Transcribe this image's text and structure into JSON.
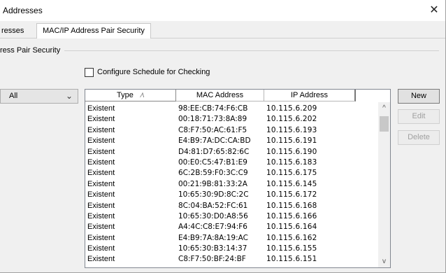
{
  "window": {
    "title": "Addresses",
    "close_glyph": "✕"
  },
  "tabs": [
    {
      "label": "resses",
      "active": false
    },
    {
      "label": "MAC/IP Address Pair Security",
      "active": true
    }
  ],
  "group": {
    "title": "ress Pair Security"
  },
  "schedule_checkbox": {
    "label": "Configure Schedule for Checking",
    "checked": false
  },
  "filter": {
    "selected": "All",
    "arrow_icon": "chevron-down-icon"
  },
  "table": {
    "columns": [
      "Type",
      "MAC Address",
      "IP Address"
    ],
    "sort_glyph": "⁄\\",
    "rows": [
      {
        "type": "Existent",
        "mac": "98:EE:CB:74:F6:CB",
        "ip": "10.115.6.209"
      },
      {
        "type": "Existent",
        "mac": "00:18:71:73:8A:89",
        "ip": "10.115.6.202"
      },
      {
        "type": "Existent",
        "mac": "C8:F7:50:AC:61:F5",
        "ip": "10.115.6.193"
      },
      {
        "type": "Existent",
        "mac": "E4:B9:7A:DC:CA:BD",
        "ip": "10.115.6.191"
      },
      {
        "type": "Existent",
        "mac": "D4:81:D7:65:82:6C",
        "ip": "10.115.6.190"
      },
      {
        "type": "Existent",
        "mac": "00:E0:C5:47:B1:E9",
        "ip": "10.115.6.183"
      },
      {
        "type": "Existent",
        "mac": "6C:2B:59:F0:3C:C9",
        "ip": "10.115.6.175"
      },
      {
        "type": "Existent",
        "mac": "00:21:9B:81:33:2A",
        "ip": "10.115.6.145"
      },
      {
        "type": "Existent",
        "mac": "10:65:30:9D:8C:2C",
        "ip": "10.115.6.172"
      },
      {
        "type": "Existent",
        "mac": "8C:04:BA:52:FC:61",
        "ip": "10.115.6.168"
      },
      {
        "type": "Existent",
        "mac": "10:65:30:D0:A8:56",
        "ip": "10.115.6.166"
      },
      {
        "type": "Existent",
        "mac": "A4:4C:C8:E7:94:F6",
        "ip": "10.115.6.164"
      },
      {
        "type": "Existent",
        "mac": "E4:B9:7A:8A:19:AC",
        "ip": "10.115.6.162"
      },
      {
        "type": "Existent",
        "mac": "10:65:30:B3:14:37",
        "ip": "10.115.6.155"
      },
      {
        "type": "Existent",
        "mac": "C8:F7:50:BF:24:BF",
        "ip": "10.115.6.151"
      }
    ]
  },
  "scrollbar": {
    "up_glyph": "^",
    "down_glyph": "v"
  },
  "buttons": {
    "new": "New",
    "edit": "Edit",
    "delete": "Delete"
  }
}
